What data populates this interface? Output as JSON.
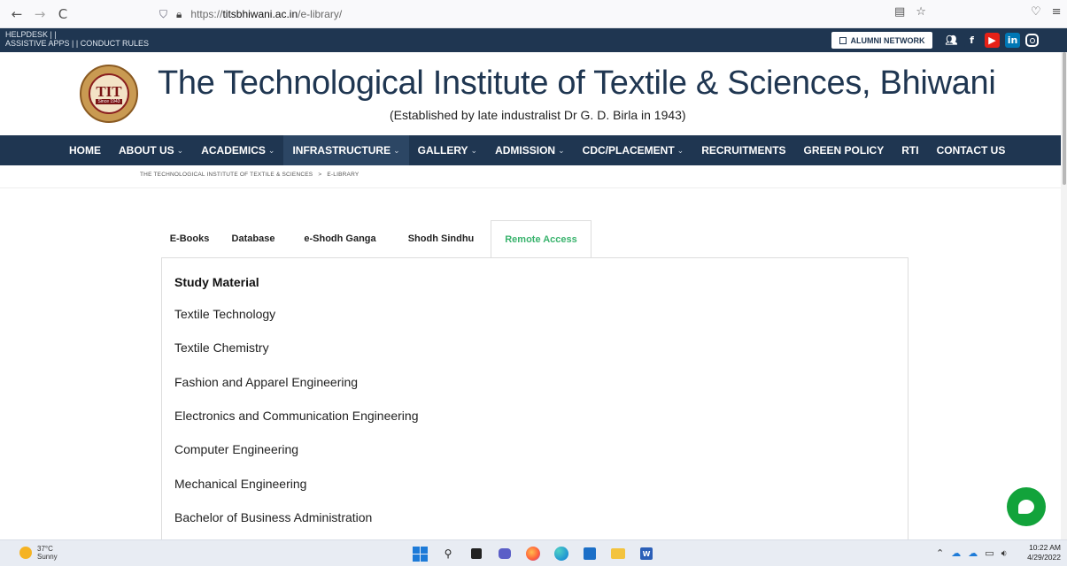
{
  "browser": {
    "back": "←",
    "forward": "→",
    "reload": "C",
    "url_prefix": "https://",
    "url_domain": "titsbhiwani.ac.in",
    "url_path": "/e-library/",
    "right_icons": [
      "reader-icon",
      "star-icon",
      "pocket-icon",
      "menu-icon"
    ]
  },
  "topstrip": {
    "line1": "HELPDESK | |",
    "line2": "ASSISTIVE APPS | | CONDUCT RULES",
    "alumni": "ALUMNI NETWORK",
    "socials": [
      "community-icon",
      "facebook-icon",
      "youtube-icon",
      "linkedin-icon",
      "instagram-icon"
    ]
  },
  "header": {
    "logo_text": "TIT",
    "logo_since": "Since 1943",
    "title": "The Technological Institute of Textile & Sciences, Bhiwani",
    "subtitle": "(Established by late industralist Dr G. D. Birla in 1943)"
  },
  "nav": {
    "items": [
      {
        "label": "HOME",
        "dropdown": false
      },
      {
        "label": "ABOUT US",
        "dropdown": true
      },
      {
        "label": "ACADEMICS",
        "dropdown": true
      },
      {
        "label": "INFRASTRUCTURE",
        "dropdown": true
      },
      {
        "label": "GALLERY",
        "dropdown": true
      },
      {
        "label": "ADMISSION",
        "dropdown": true
      },
      {
        "label": "CDC/PLACEMENT",
        "dropdown": true
      },
      {
        "label": "RECRUITMENTS",
        "dropdown": false
      },
      {
        "label": "GREEN POLICY",
        "dropdown": false
      },
      {
        "label": "RTI",
        "dropdown": false
      },
      {
        "label": "CONTACT US",
        "dropdown": false
      }
    ],
    "active": "INFRASTRUCTURE"
  },
  "breadcrumb": {
    "home": "THE TECHNOLOGICAL INSTITUTE OF TEXTILE & SCIENCES",
    "sep": ">",
    "current": "E-LIBRARY"
  },
  "tabs": {
    "items": [
      "E-Books",
      "Database",
      "e-Shodh Ganga",
      "Shodh Sindhu",
      "Remote Access"
    ],
    "active": "Remote Access"
  },
  "content": {
    "heading": "Study Material",
    "subjects": [
      "Textile Technology",
      "Textile Chemistry",
      "Fashion and Apparel Engineering",
      "Electronics and Communication Engineering",
      "Computer Engineering",
      "Mechanical Engineering",
      "Bachelor of Business Administration"
    ]
  },
  "taskbar": {
    "temp": "37°C",
    "condition": "Sunny",
    "time": "10:22 AM",
    "date": "4/29/2022"
  },
  "colors": {
    "navy": "#1f3651",
    "active_tab": "#39b36d",
    "chat": "#12a33b"
  }
}
